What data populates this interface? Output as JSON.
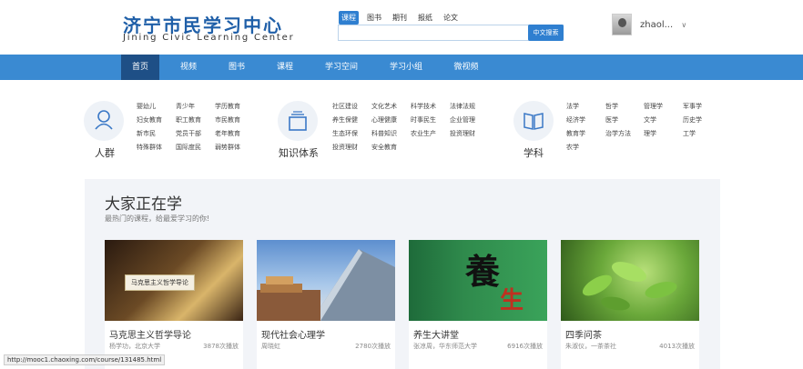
{
  "header": {
    "logo_cn": "济宁市民学习中心",
    "logo_en": "Jining Civic Learning Center",
    "search_tabs": [
      "课程",
      "图书",
      "期刊",
      "报纸",
      "论文"
    ],
    "search_button": "中文搜索",
    "username": "zhaol...",
    "dropdown_glyph": "∨"
  },
  "nav": {
    "items": [
      "首页",
      "视频",
      "图书",
      "课程",
      "学习空间",
      "学习小组",
      "微视频"
    ]
  },
  "categories": [
    {
      "title": "人群",
      "icon": "person-icon",
      "tags": [
        "婴幼儿",
        "青少年",
        "学历教育",
        "妇女教育",
        "职工教育",
        "市民教育",
        "新市民",
        "党员干部",
        "老年教育",
        "特殊群体",
        "国际度民",
        "弱势群体"
      ]
    },
    {
      "title": "知识体系",
      "icon": "stack-icon",
      "tags": [
        "社区建设",
        "文化艺术",
        "科学技术",
        "法律法规",
        "养生保健",
        "心理健康",
        "时事民生",
        "企业管理",
        "生态环保",
        "科普知识",
        "农业生产",
        "投资理财",
        "投资理财",
        "安全教育"
      ]
    },
    {
      "title": "学科",
      "icon": "book-icon",
      "tags": [
        "法学",
        "哲学",
        "管理学",
        "军事学",
        "经济学",
        "医学",
        "文学",
        "历史学",
        "教育学",
        "治学方法",
        "理学",
        "工学",
        "农学"
      ]
    }
  ],
  "learn": {
    "title": "大家正在学",
    "subtitle": "最热门的课程，给最爱学习的你!"
  },
  "courses": [
    {
      "title": "马克思主义哲学导论",
      "meta": "杨学功，北京大学",
      "count": "3878次播放",
      "overlay": "马克思主义哲学导论"
    },
    {
      "title": "现代社会心理学",
      "meta": "周晓虹",
      "count": "2780次播放",
      "overlay": ""
    },
    {
      "title": "养生大讲堂",
      "meta": "张凉周，华东师范大学",
      "count": "6916次播放",
      "overlay": ""
    },
    {
      "title": "四季问茶",
      "meta": "朱淑仪，一茶茶社",
      "count": "4013次播放",
      "overlay": ""
    }
  ],
  "course3_glyphs": [
    "養",
    "生"
  ],
  "status_url": "http://mooc1.chaoxing.com/course/131485.html",
  "colors": {
    "nav": "#3a8ad2",
    "nav_active": "#1e4f86",
    "brand": "#1f5fa8",
    "search_btn": "#2f7fd0"
  }
}
